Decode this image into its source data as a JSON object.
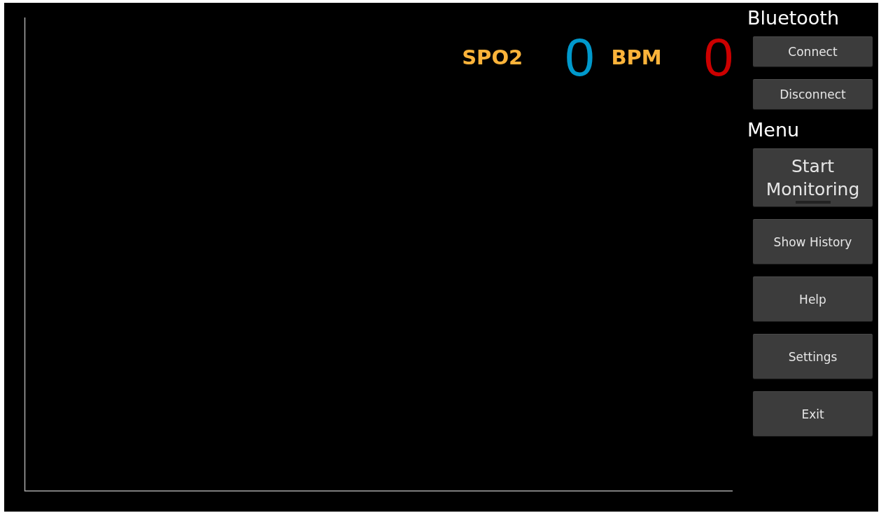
{
  "readings": [
    {
      "label": "SPO2",
      "value": "0",
      "color": "#0099cc"
    },
    {
      "label": "BPM",
      "value": "0",
      "color": "#cc0000"
    }
  ],
  "sidebar": {
    "sections": [
      {
        "title": "Bluetooth",
        "buttons": [
          {
            "label": "Connect",
            "kind": "compact",
            "focused": false
          },
          {
            "label": "Disconnect",
            "kind": "compact",
            "focused": false
          }
        ]
      },
      {
        "title": "Menu",
        "buttons": [
          {
            "label": "Start Monitoring",
            "kind": "tall",
            "focused": true
          },
          {
            "label": "Show History",
            "kind": "regular",
            "focused": false
          },
          {
            "label": "Help",
            "kind": "regular",
            "focused": false
          },
          {
            "label": "Settings",
            "kind": "regular",
            "focused": false
          },
          {
            "label": "Exit",
            "kind": "regular",
            "focused": false
          }
        ]
      }
    ]
  }
}
